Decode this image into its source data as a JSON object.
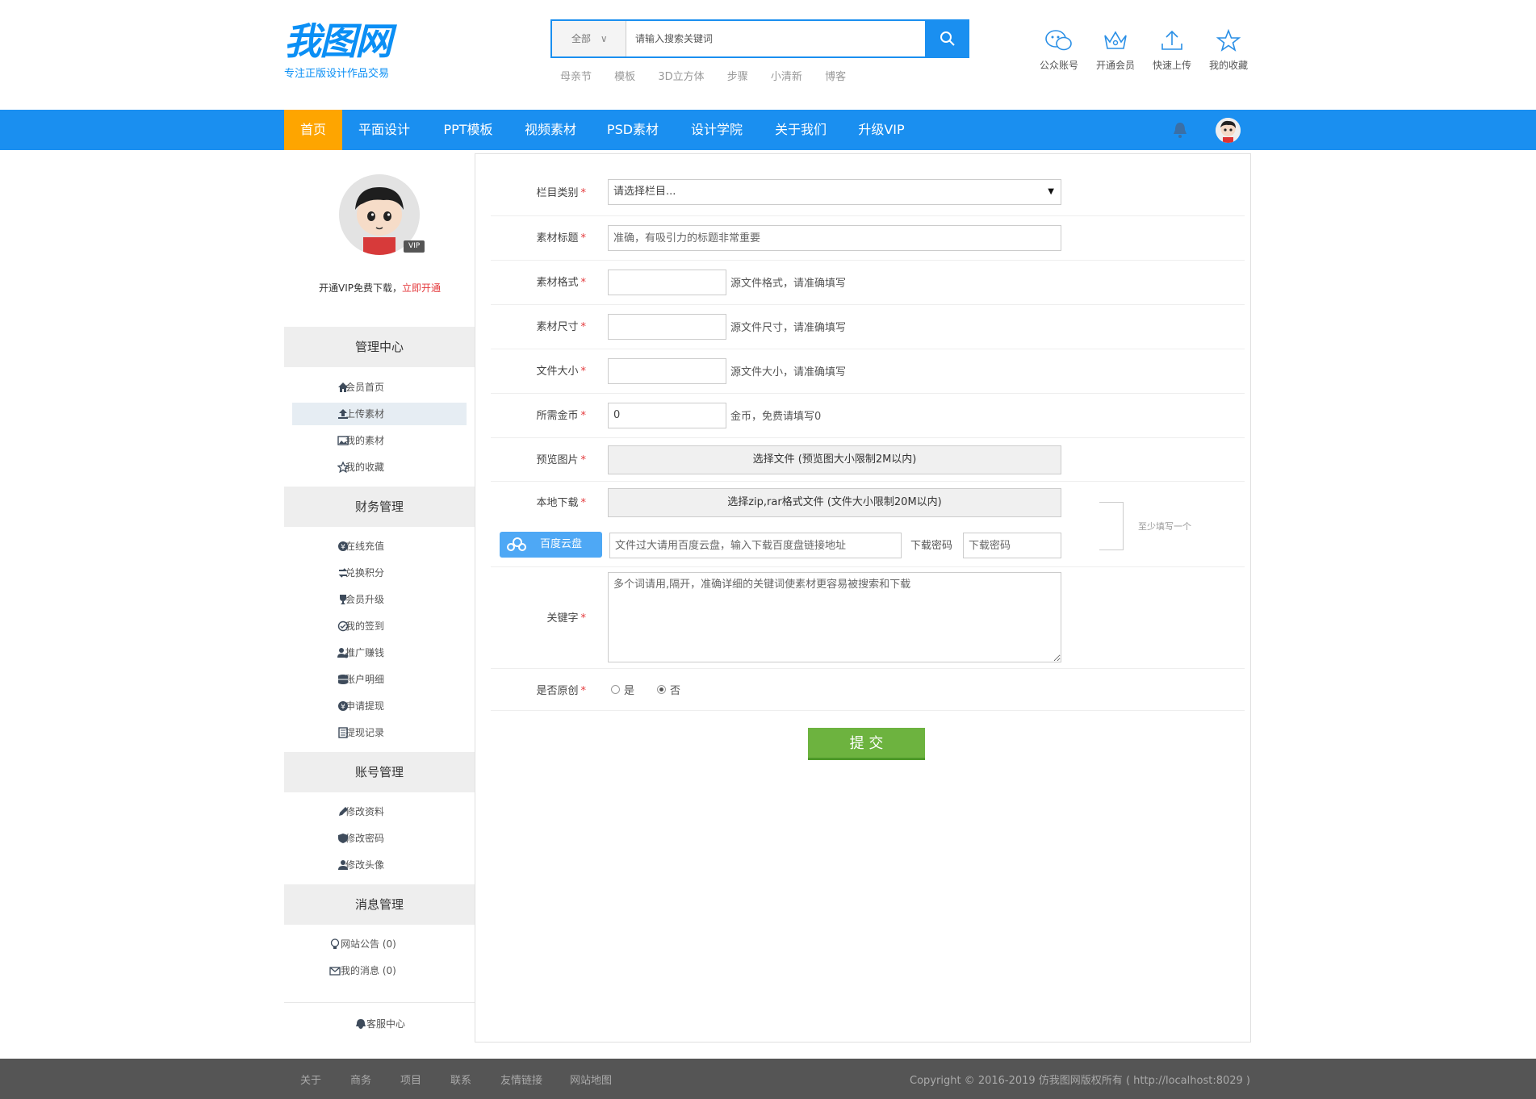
{
  "logo": {
    "mark": "我图网",
    "tagline": "专注正版设计作品交易"
  },
  "search": {
    "category": "全部",
    "placeholder": "请输入搜索关键词"
  },
  "hot_words": [
    "母亲节",
    "模板",
    "3D立方体",
    "步骤",
    "小清新",
    "博客"
  ],
  "quick_links": [
    {
      "label": "公众账号",
      "icon": "wechat-icon"
    },
    {
      "label": "开通会员",
      "icon": "crown-icon"
    },
    {
      "label": "快速上传",
      "icon": "upload-icon"
    },
    {
      "label": "我的收藏",
      "icon": "star-icon"
    }
  ],
  "nav": {
    "items": [
      "首页",
      "平面设计",
      "PPT模板",
      "视频素材",
      "PSD素材",
      "设计学院",
      "关于我们",
      "升级VIP"
    ],
    "active": "首页"
  },
  "profile": {
    "vip_badge": "VIP",
    "note": "开通VIP免费下载，",
    "note_link": "立即开通"
  },
  "sidebar": {
    "sections": [
      {
        "title": "管理中心",
        "items": [
          {
            "label": "会员首页",
            "icon": "home-icon"
          },
          {
            "label": "上传素材",
            "icon": "upload-icon",
            "active": true
          },
          {
            "label": "我的素材",
            "icon": "image-icon"
          },
          {
            "label": "我的收藏",
            "icon": "star-icon"
          }
        ]
      },
      {
        "title": "财务管理",
        "items": [
          {
            "label": "在线充值",
            "icon": "yen-icon"
          },
          {
            "label": "兑换积分",
            "icon": "exchange-icon"
          },
          {
            "label": "会员升级",
            "icon": "trophy-icon"
          },
          {
            "label": "我的签到",
            "icon": "check-circle-icon"
          },
          {
            "label": "推广赚钱",
            "icon": "user-money-icon"
          },
          {
            "label": "账户明细",
            "icon": "database-icon"
          },
          {
            "label": "申请提现",
            "icon": "yen-icon"
          },
          {
            "label": "提现记录",
            "icon": "list-icon"
          }
        ]
      },
      {
        "title": "账号管理",
        "items": [
          {
            "label": "修改资料",
            "icon": "pencil-icon"
          },
          {
            "label": "修改密码",
            "icon": "shield-icon"
          },
          {
            "label": "修改头像",
            "icon": "user-icon"
          }
        ]
      },
      {
        "title": "消息管理",
        "items": [
          {
            "label": "网站公告 (0)",
            "icon": "bulb-icon"
          },
          {
            "label": "我的消息 (0)",
            "icon": "mail-icon"
          }
        ]
      }
    ],
    "service": "客服中心"
  },
  "form": {
    "category": {
      "label": "栏目类别",
      "value": "请选择栏目..."
    },
    "title": {
      "label": "素材标题",
      "placeholder": "准确，有吸引力的标题非常重要"
    },
    "format": {
      "label": "素材格式",
      "hint": "源文件格式，请准确填写"
    },
    "size": {
      "label": "素材尺寸",
      "hint": "源文件尺寸，请准确填写"
    },
    "filesize": {
      "label": "文件大小",
      "hint": "源文件大小，请准确填写"
    },
    "coins": {
      "label": "所需金币",
      "value": "0",
      "hint": "金币，免费请填写0"
    },
    "preview": {
      "label": "预览图片",
      "button": "选择文件 (预览图大小限制2M以内)"
    },
    "local": {
      "label": "本地下载",
      "button": "选择zip,rar格式文件 (文件大小限制20M以内)"
    },
    "baidu": {
      "button": "百度云盘",
      "placeholder": "文件过大请用百度云盘，输入下载百度盘链接地址",
      "pwd_label": "下载密码",
      "pwd_placeholder": "下载密码"
    },
    "at_least_one": "至少填写一个",
    "keywords": {
      "label": "关键字",
      "placeholder": "多个词请用,隔开，准确详细的关键词使素材更容易被搜索和下载"
    },
    "original": {
      "label": "是否原创",
      "yes": "是",
      "no": "否",
      "selected": "否"
    },
    "submit": "提 交"
  },
  "footer": {
    "links": [
      "关于",
      "商务",
      "项目",
      "联系",
      "友情链接",
      "网站地图"
    ],
    "copyright": "Copyright © 2016-2019 仿我图网版权所有 ( http://localhost:8029 )"
  },
  "colors": {
    "brand": "#1a8ff0",
    "active_nav": "#fea500",
    "submit": "#6db33f",
    "required": "#e4393c"
  }
}
